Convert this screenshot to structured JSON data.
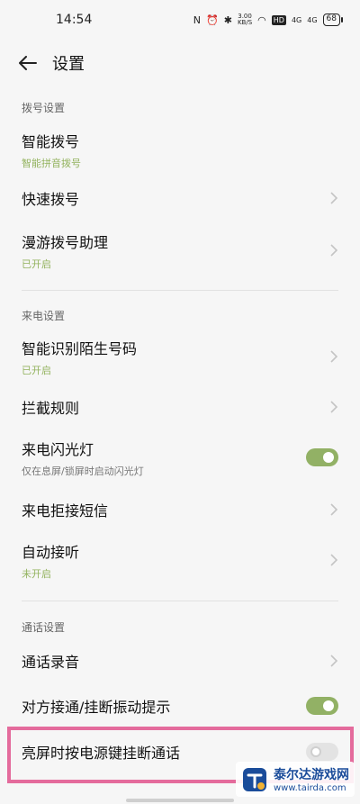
{
  "status_bar": {
    "time": "14:54",
    "speed": "3.00\nKB/S",
    "hd": "HD",
    "sig1": "4G",
    "sig2": "4G",
    "battery": "68"
  },
  "header": {
    "title": "设置"
  },
  "sections": [
    {
      "label": "拨号设置"
    },
    {
      "label": "来电设置"
    },
    {
      "label": "通话设置"
    }
  ],
  "items": [
    {
      "title": "智能拨号",
      "subtitle": "智能拼音拨号"
    },
    {
      "title": "快速拨号"
    },
    {
      "title": "漫游拨号助理",
      "subtitle": "已开启"
    },
    {
      "title": "智能识别陌生号码",
      "subtitle": "已开启"
    },
    {
      "title": "拦截规则"
    },
    {
      "title": "来电闪光灯",
      "subtitle": "仅在息屏/锁屏时启动闪光灯",
      "toggle": true
    },
    {
      "title": "来电拒接短信"
    },
    {
      "title": "自动接听",
      "subtitle": "未开启"
    },
    {
      "title": "通话录音"
    },
    {
      "title": "对方接通/挂断振动提示",
      "toggle": true
    },
    {
      "title": "亮屏时按电源键挂断通话",
      "toggle": false
    }
  ],
  "watermark": {
    "title": "泰尔达游戏网",
    "url": "www.tairda.com"
  },
  "colors": {
    "accent_green": "#93b35e",
    "highlight": "#e46b9c"
  }
}
